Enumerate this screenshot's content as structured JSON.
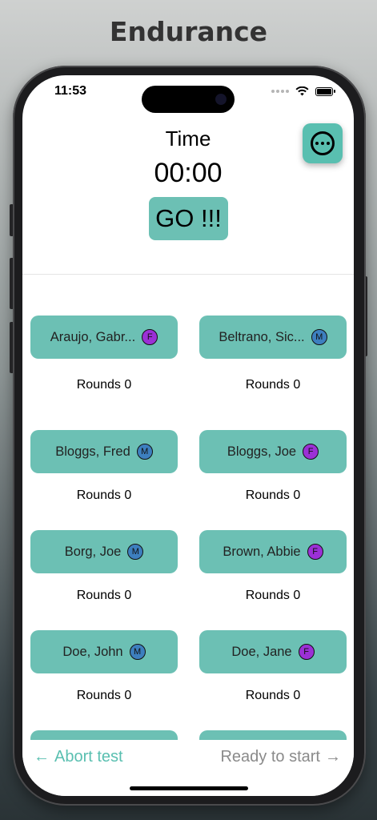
{
  "page_title": "Endurance",
  "status_bar": {
    "time": "11:53"
  },
  "header": {
    "time_label": "Time",
    "timer": "00:00",
    "go_label": "GO !!!"
  },
  "athletes": [
    {
      "name": "Araujo, Gabr...",
      "gender": "F",
      "rounds": "Rounds 0"
    },
    {
      "name": "Beltrano, Sic...",
      "gender": "M",
      "rounds": "Rounds 0"
    },
    {
      "name": "Bloggs, Fred",
      "gender": "M",
      "rounds": "Rounds 0"
    },
    {
      "name": "Bloggs, Joe",
      "gender": "F",
      "rounds": "Rounds 0"
    },
    {
      "name": "Borg, Joe",
      "gender": "M",
      "rounds": "Rounds 0"
    },
    {
      "name": "Brown, Abbie",
      "gender": "F",
      "rounds": "Rounds 0"
    },
    {
      "name": "Doe, John",
      "gender": "M",
      "rounds": "Rounds 0"
    },
    {
      "name": "Doe, Jane",
      "gender": "F",
      "rounds": "Rounds 0"
    },
    {
      "name": "",
      "gender": "",
      "rounds": ""
    },
    {
      "name": "",
      "gender": "",
      "rounds": ""
    }
  ],
  "footer": {
    "abort_label": "Abort test",
    "ready_label": "Ready to start"
  },
  "colors": {
    "accent": "#6cc0b4",
    "female": "#9b30d6",
    "male": "#3d7fbf"
  },
  "icons": {
    "menu": "ellipsis-circle-icon",
    "abort": "arrow-left-icon",
    "ready": "arrow-right-icon"
  }
}
